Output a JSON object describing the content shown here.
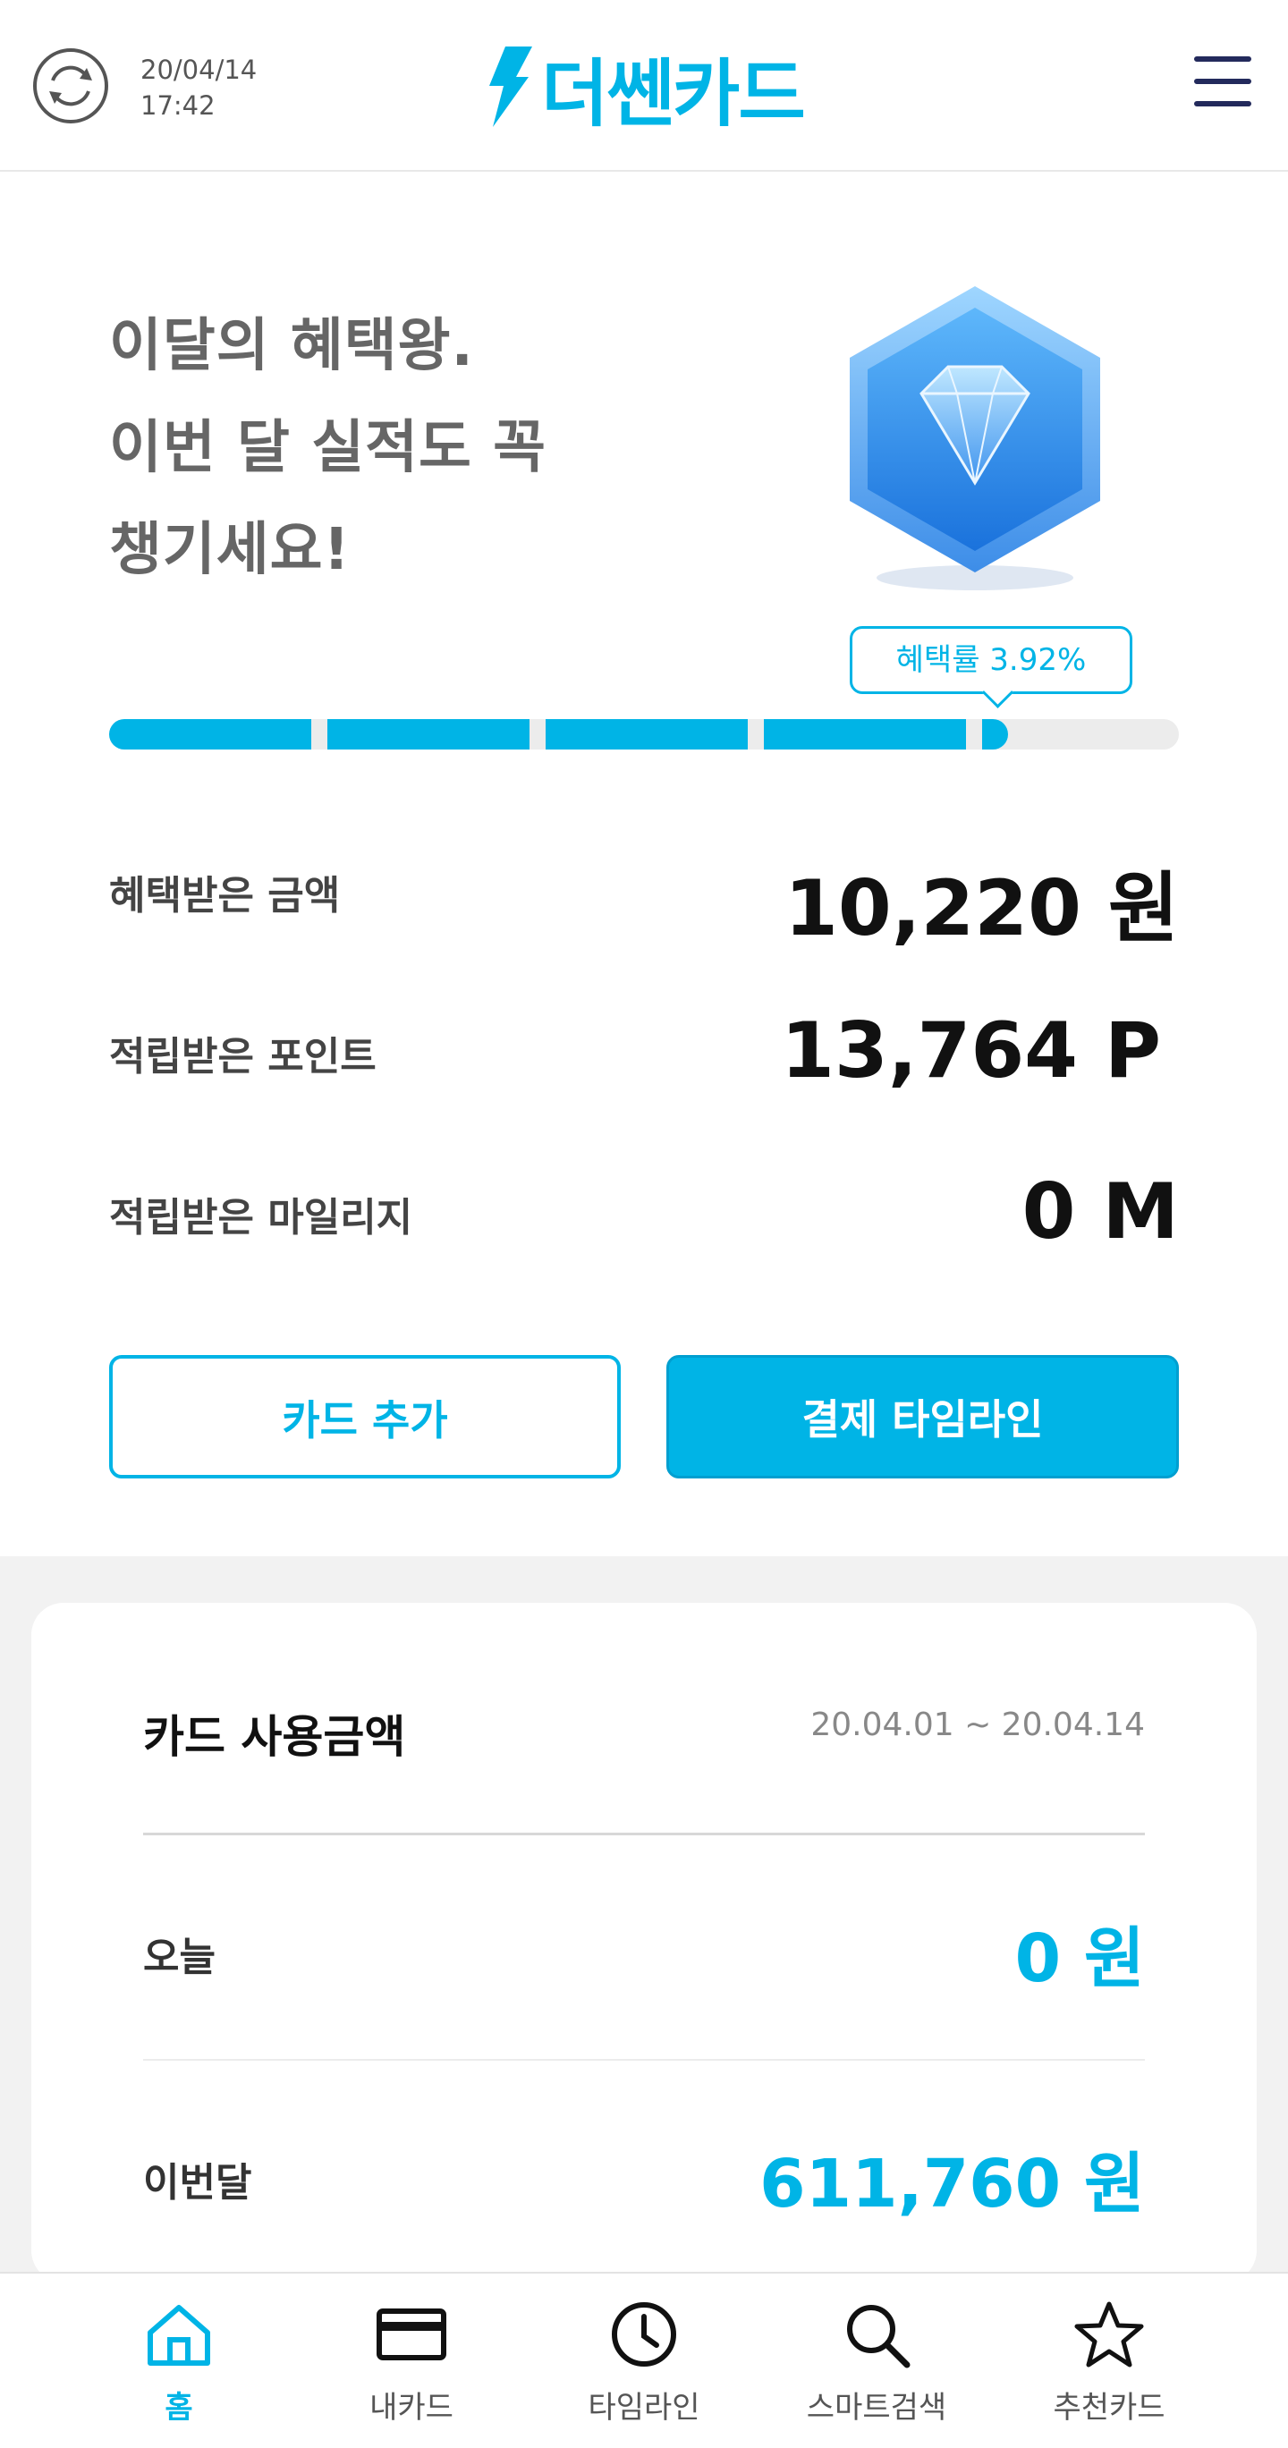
{
  "header": {
    "date": "20/04/14",
    "time": "17:42",
    "logo_text": "더쎈카드"
  },
  "hero": {
    "line1": "이달의 혜택왕.",
    "line2": "이번 달 실적도 꼭",
    "line3": "챙기세요!"
  },
  "benefit": {
    "rate_label": "혜택률 3.92%",
    "progress_fraction": 0.84,
    "rows": [
      {
        "label": "혜택받은 금액",
        "value": "10,220 원"
      },
      {
        "label": "적립받은 포인트",
        "value": "13,764 P"
      },
      {
        "label": "적립받은 마일리지",
        "value": "0 M"
      }
    ]
  },
  "actions": {
    "add_card": "카드 추가",
    "payment_timeline": "결제 타임라인"
  },
  "usage": {
    "title": "카드 사용금액",
    "range": "20.04.01 ~ 20.04.14",
    "rows": [
      {
        "label": "오늘",
        "value": "0 원"
      },
      {
        "label": "이번달",
        "value": "611,760 원"
      }
    ]
  },
  "nav": {
    "items": [
      {
        "label": "홈",
        "icon": "home-icon",
        "active": true
      },
      {
        "label": "내카드",
        "icon": "card-icon",
        "active": false
      },
      {
        "label": "타임라인",
        "icon": "clock-icon",
        "active": false
      },
      {
        "label": "스마트검색",
        "icon": "search-icon",
        "active": false
      },
      {
        "label": "추천카드",
        "icon": "star-icon",
        "active": false
      }
    ]
  },
  "colors": {
    "accent": "#00b4e6",
    "navy": "#232a5c",
    "gray_background": "#f2f2f2"
  }
}
